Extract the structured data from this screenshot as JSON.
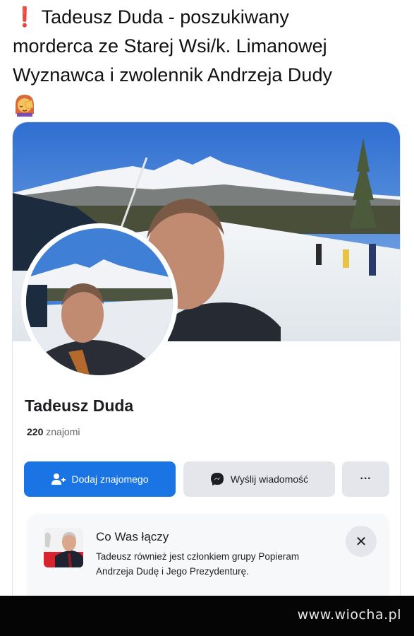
{
  "post": {
    "alert_mark": "❗",
    "line1": "Tadeusz Duda - poszukiwany",
    "line2": "morderca ze Starej Wsi/k. Limanowej",
    "line3": "Wyznawca i zwolennik Andrzeja Dudy",
    "emoji_icon": "woman-facepalming-icon"
  },
  "profile": {
    "name": "Tadeusz Duda",
    "friends_count": "220",
    "friends_label": "znajomi",
    "add_friend_label": "Dodaj znajomego",
    "message_label": "Wyślij wiadomość",
    "more_label": "···"
  },
  "mutual": {
    "title": "Co Was łączy",
    "description": "Tadeusz również jest członkiem grupy Popieram Andrzeja Dudę i Jego Prezydenturę.",
    "close_label": "✕"
  },
  "watermark": {
    "text": "www.wiocha.pl"
  },
  "colors": {
    "accent": "#1b74e4",
    "secondary_button": "#e4e6eb",
    "alert": "#e2232b"
  }
}
